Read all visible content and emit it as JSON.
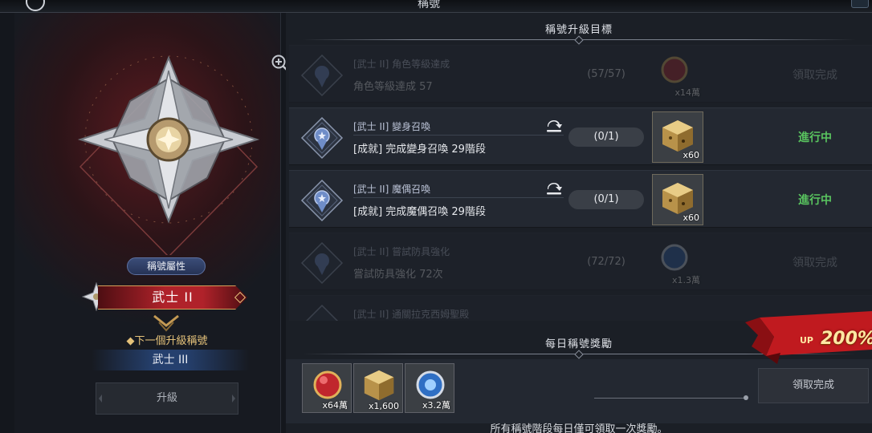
{
  "window": {
    "title": "稱號"
  },
  "left": {
    "attr_button": "稱號屬性",
    "current_title": "武士 II",
    "next_label": "◆下一個升級稱號",
    "next_title": "武士 III",
    "upgrade_button": "升級"
  },
  "goals_section": {
    "header": "稱號升級目標",
    "goals": [
      {
        "name": "[武士 II] 角色等級達成",
        "desc": "角色等級達成 57",
        "progress": "(57/57)",
        "reward_icon": "red-orb-icon",
        "reward_count": "x14萬",
        "status": "領取完成"
      },
      {
        "name": "[武士 II] 變身召喚",
        "desc": "[成就] 完成變身召喚 29階段",
        "progress": "(0/1)",
        "reward_icon": "gold-cube-icon",
        "reward_count": "x60",
        "status": "進行中"
      },
      {
        "name": "[武士 II] 魔偶召喚",
        "desc": "[成就] 完成魔偶召喚 29階段",
        "progress": "(0/1)",
        "reward_icon": "gold-cube-icon",
        "reward_count": "x60",
        "status": "進行中"
      },
      {
        "name": "[武士 II] 嘗試防具強化",
        "desc": "嘗試防具強化 72次",
        "progress": "(72/72)",
        "reward_icon": "blue-orb-icon",
        "reward_count": "x1.3萬",
        "status": "領取完成"
      },
      {
        "name": "[武士 II] 通關拉克西姆聖殿",
        "desc": "",
        "progress": "",
        "reward_icon": "",
        "reward_count": "",
        "status": ""
      }
    ]
  },
  "daily_section": {
    "header": "每日稱號獎勵",
    "rewards": [
      {
        "icon": "red-orb-icon",
        "count": "x64萬"
      },
      {
        "icon": "gold-cube-icon",
        "count": "x1,600"
      },
      {
        "icon": "blue-orb-icon",
        "count": "x3.2萬"
      }
    ],
    "claim_button": "領取完成",
    "footnote": "所有稱號階段每日僅可領取一次獎勵。",
    "up_badge": {
      "prefix": "UP",
      "value": "200%"
    }
  },
  "colors": {
    "in_progress": "#59c45f",
    "accent_red": "#b0222a",
    "gold": "#e5c27a"
  }
}
